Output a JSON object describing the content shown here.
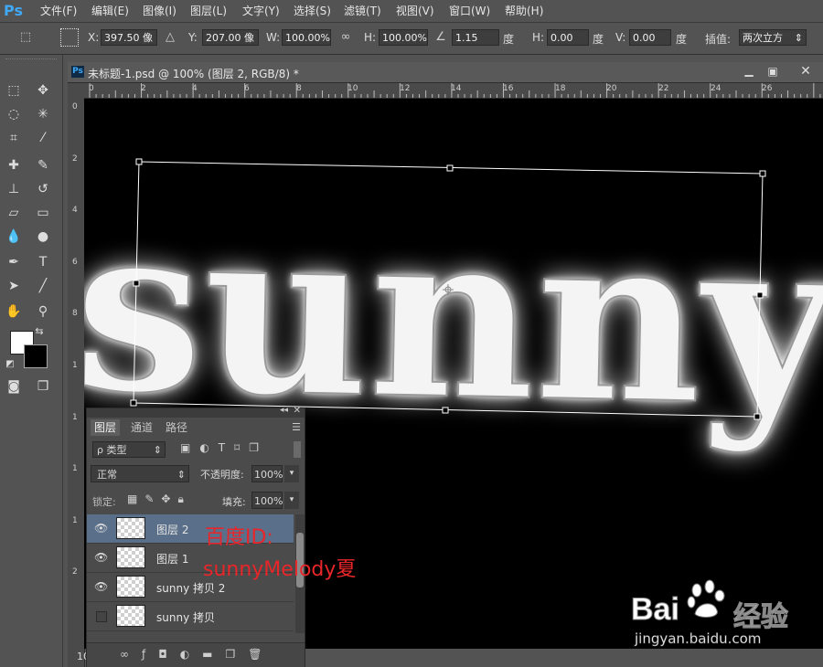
{
  "app": {
    "logo": "Ps"
  },
  "menu": [
    "文件(F)",
    "编辑(E)",
    "图像(I)",
    "图层(L)",
    "文字(Y)",
    "选择(S)",
    "滤镜(T)",
    "视图(V)",
    "窗口(W)",
    "帮助(H)"
  ],
  "options": {
    "x_label": "X:",
    "x_value": "397.50 像",
    "y_label": "Y:",
    "y_value": "207.00 像",
    "w_label": "W:",
    "w_value": "100.00%",
    "h_label": "H:",
    "h_value": "100.00%",
    "angle_value": "1.15",
    "angle_unit": "度",
    "hskew_label": "H:",
    "hskew_value": "0.00",
    "hskew_unit": "度",
    "vskew_label": "V:",
    "vskew_value": "0.00",
    "vskew_unit": "度",
    "interp_label": "插值:",
    "interp_value": "两次立方"
  },
  "document": {
    "title": "未标题-1.psd @ 100% (图层 2, RGB/8) *",
    "ruler_top": [
      "0",
      "2",
      "4",
      "6",
      "8",
      "10",
      "12",
      "14",
      "16",
      "18",
      "20",
      "22",
      "24",
      "26"
    ],
    "ruler_left": [
      "0",
      "2",
      "4",
      "6",
      "8",
      "1",
      "1",
      "1",
      "1",
      "2"
    ],
    "canvas_text": "sunny",
    "zoom": "10"
  },
  "layers_panel": {
    "tabs": [
      "图层",
      "通道",
      "路径"
    ],
    "filter_label": "ρ 类型",
    "blend_mode": "正常",
    "opacity_label": "不透明度:",
    "opacity_value": "100%",
    "lock_label": "锁定:",
    "fill_label": "填充:",
    "fill_value": "100%",
    "layers": [
      {
        "name": "图层 2",
        "visible": true,
        "selected": true
      },
      {
        "name": "图层 1",
        "visible": true,
        "selected": false
      },
      {
        "name": "sunny 拷贝 2",
        "visible": true,
        "selected": false
      },
      {
        "name": "sunny 拷贝",
        "visible": false,
        "selected": false
      }
    ]
  },
  "watermark": {
    "red_line1": "百度ID:",
    "red_line2": "sunnyMelody夏",
    "brand": "Bai",
    "brand_du": "du",
    "brand_cn": "经验",
    "brand_url": "jingyan.baidu.com"
  }
}
